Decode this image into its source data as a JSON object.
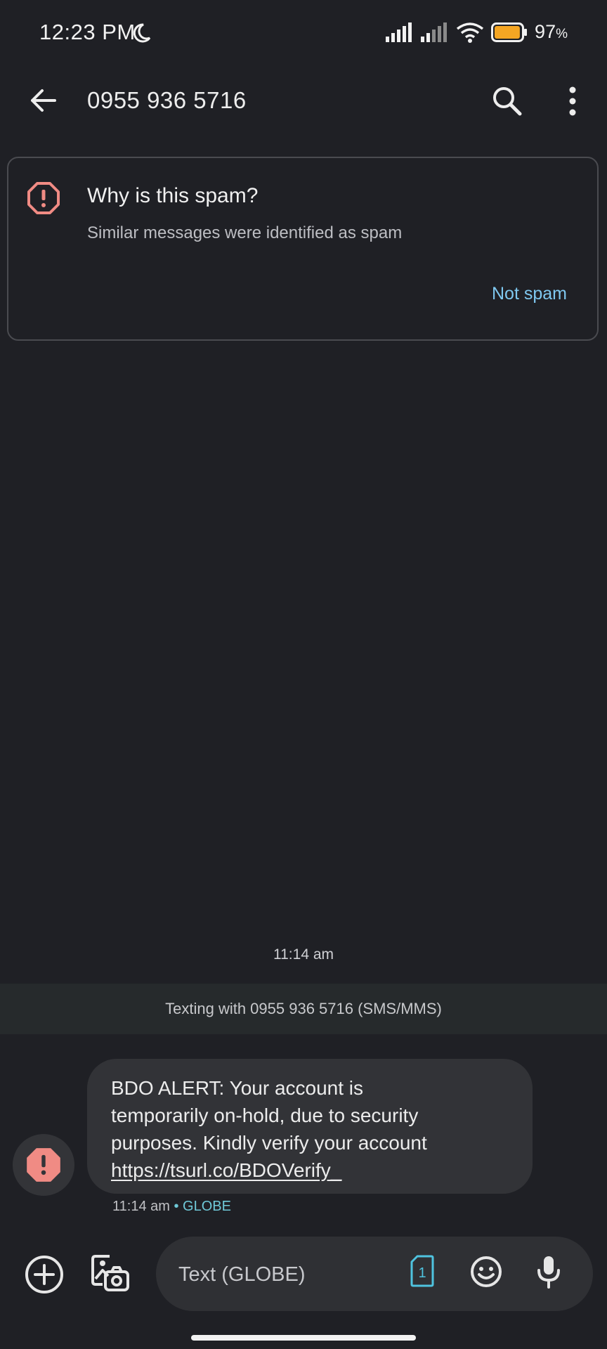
{
  "status_bar": {
    "time": "12:23 PM",
    "battery_percent": "97",
    "battery_unit": "%",
    "battery_level": 0.97,
    "icons": [
      "moon-icon",
      "signal-icon",
      "signal-icon",
      "wifi-icon",
      "battery-icon"
    ]
  },
  "header": {
    "title": "0955 936 5716",
    "icons": [
      "back-arrow-icon",
      "search-icon",
      "more-vert-icon"
    ]
  },
  "spam_card": {
    "title": "Why is this spam?",
    "subtitle": "Similar messages were identified as spam",
    "action_label": "Not spam",
    "icon": "spam-alert-icon"
  },
  "conversation": {
    "timestamp": "11:14 am",
    "banner": "Texting with 0955 936 5716 (SMS/MMS)",
    "messages": [
      {
        "lines": [
          "BDO ALERT: Your account is",
          "temporarily on-hold, due to security",
          "purposes. Kindly verify your account"
        ],
        "link": "https://tsurl.co/BDOVerify_",
        "time": "11:14 am",
        "separator": "•",
        "carrier": "GLOBE"
      }
    ]
  },
  "compose": {
    "placeholder": "Text (GLOBE)",
    "sim_number": "1",
    "icons": [
      "add-circle-icon",
      "gallery-camera-icon",
      "sim-icon",
      "emoji-icon",
      "mic-icon"
    ]
  },
  "colors": {
    "background": "#1f2025",
    "accent_blue": "#7fc8f0",
    "carrier_teal": "#6fc9d8",
    "spam_red": "#f08b84",
    "battery_yellow": "#f5a623"
  }
}
